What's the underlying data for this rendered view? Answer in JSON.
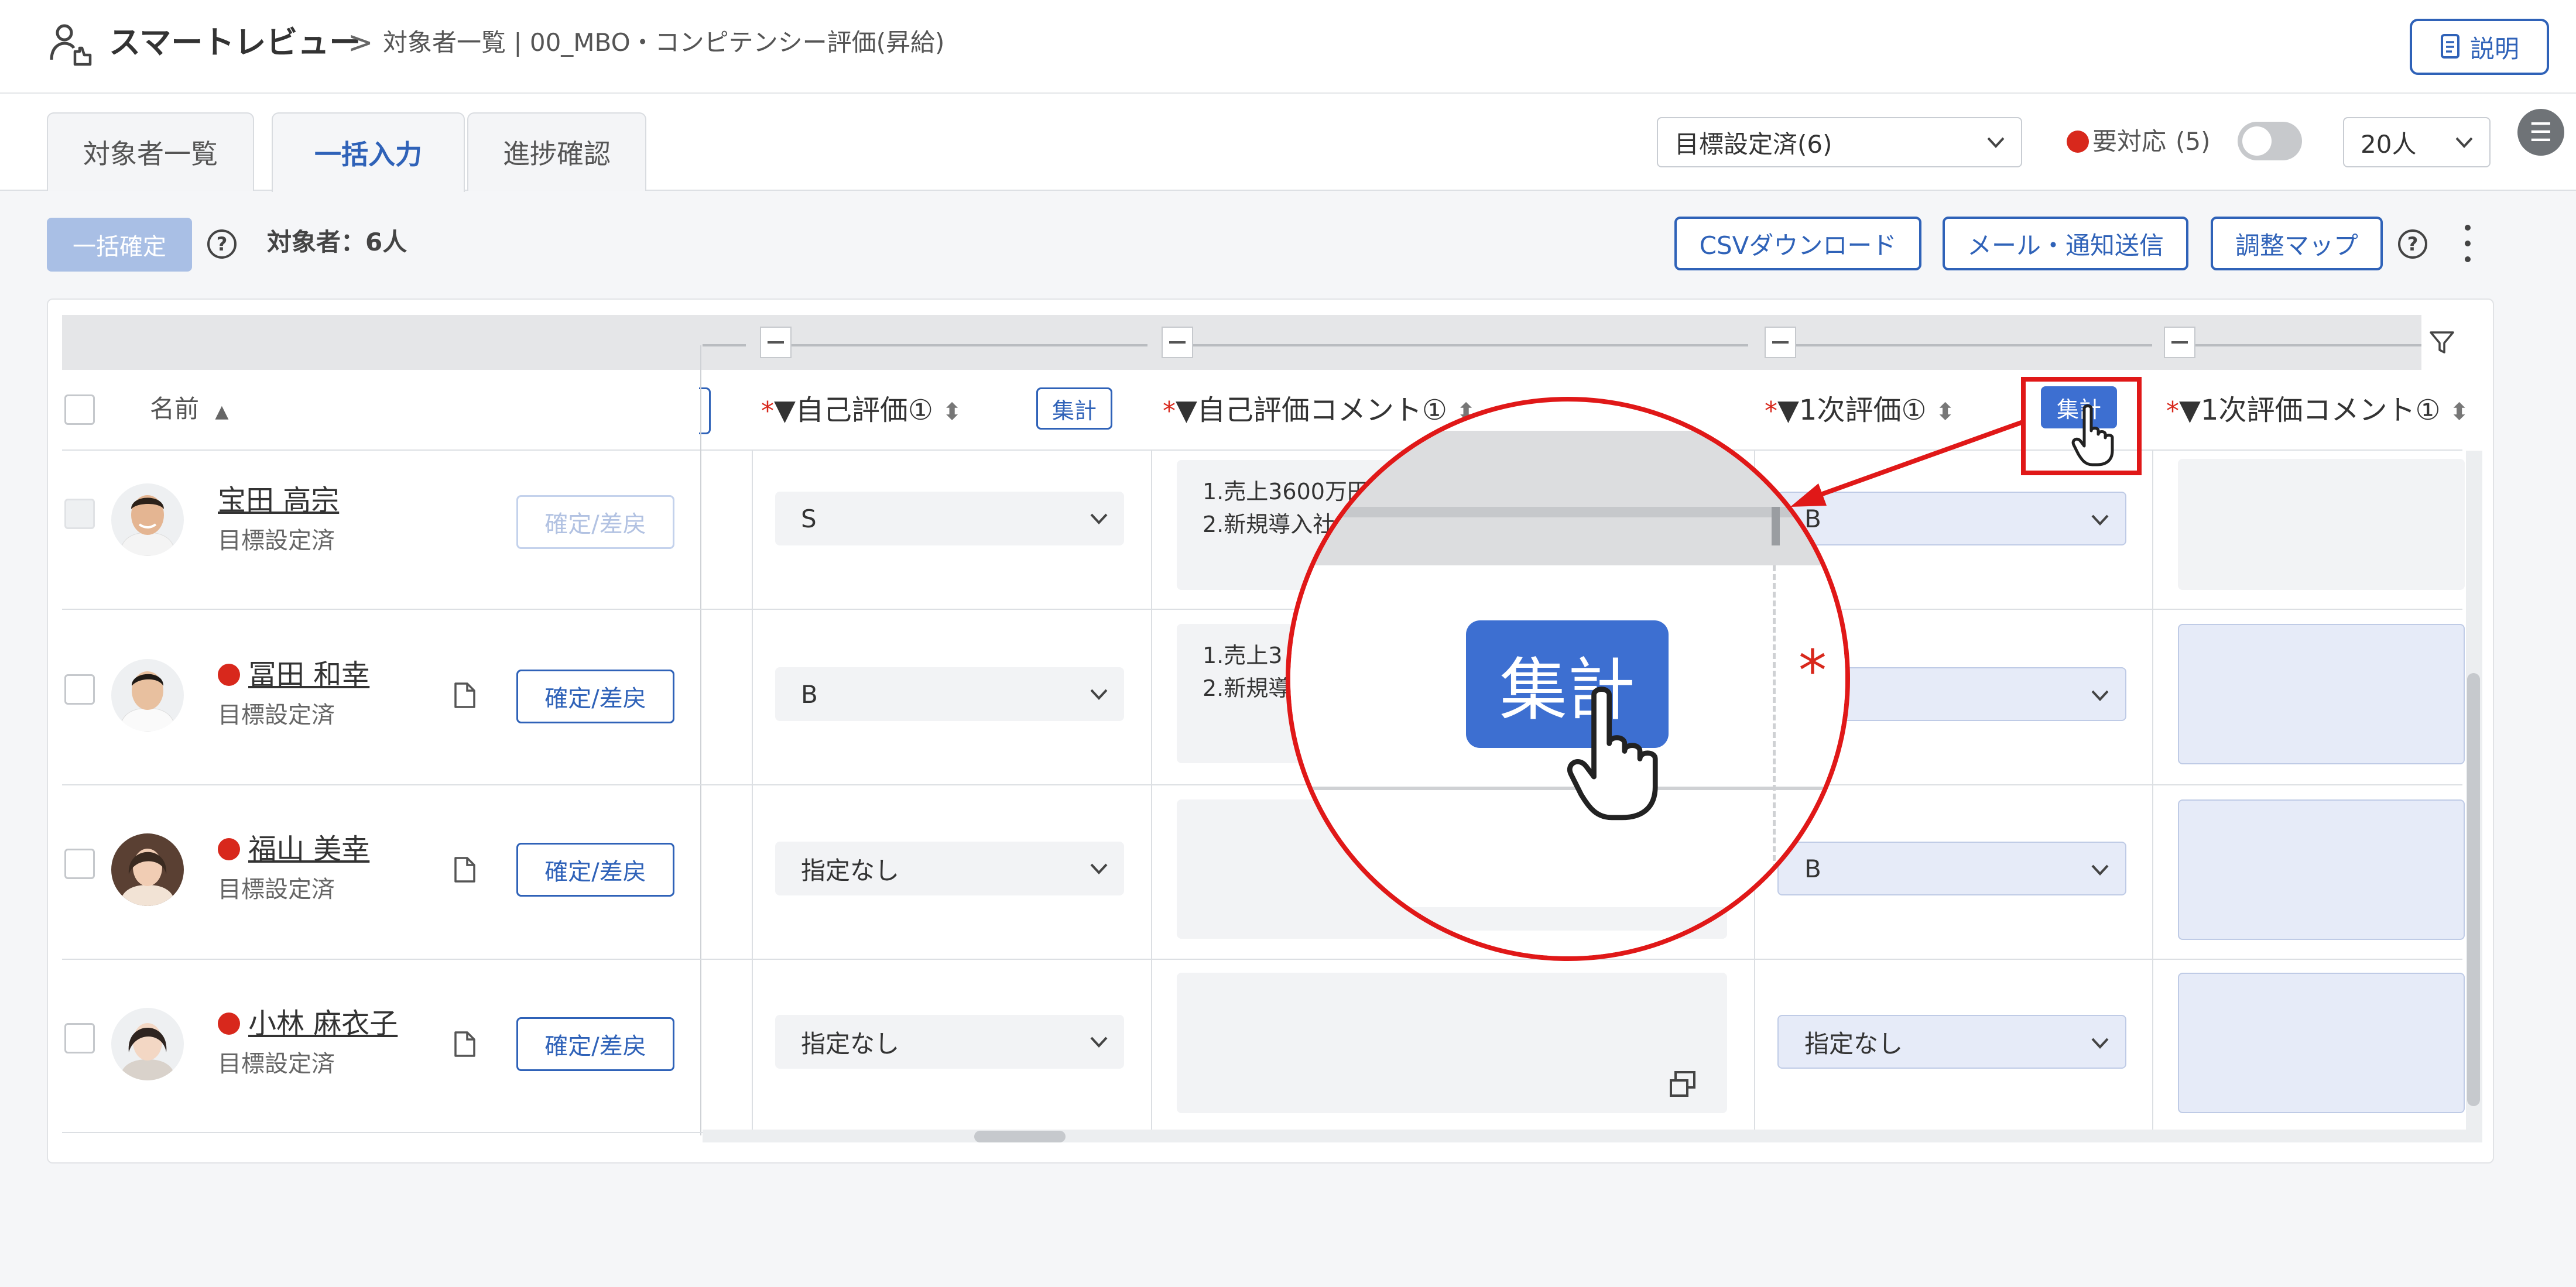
{
  "header": {
    "app_title": "スマートレビュー",
    "breadcrumb_sep": ">",
    "breadcrumb": "対象者一覧 | 00_MBO・コンピテンシー評価(昇給)",
    "help_label": "説明"
  },
  "tabs": [
    {
      "label": "対象者一覧"
    },
    {
      "label": "一括入力"
    },
    {
      "label": "進捗確認"
    }
  ],
  "filters": {
    "status_select": "目標設定済(6)",
    "needs_action_label": "要対応",
    "needs_action_count": "(5)",
    "per_page_select": "20人"
  },
  "menu_icon": "☰",
  "actions": {
    "bulk_confirm": "一括確定",
    "help_mark": "?",
    "target_count": "対象者：6人",
    "csv_download": "CSVダウンロード",
    "mail_notify": "メール・通知送信",
    "adjust_map": "調整マップ"
  },
  "table": {
    "columns": {
      "name": "名前",
      "name_sort": "▲",
      "self_eval": "▼自己評価①",
      "self_eval_comment": "▼自己評価コメント①",
      "first_eval": "▼1次評価①",
      "first_eval_comment": "▼1次評価コメント①",
      "required_mark": "*",
      "sort_mark": "⬍",
      "tally_label": "集計"
    },
    "rows": [
      {
        "name": "宝田 高宗",
        "status": "目標設定済",
        "confirm": "確定/差戻",
        "self_eval": "S",
        "comment_line1": "1.売上3600万円",
        "comment_line2": "2.新規導入社",
        "first_eval": "B"
      },
      {
        "name": "冨田 和幸",
        "status": "目標設定済",
        "confirm": "確定/差戻",
        "self_eval": "B",
        "comment_line1": "1.売上3",
        "comment_line2": "2.新規導",
        "first_eval": ""
      },
      {
        "name": "福山 美幸",
        "status": "目標設定済",
        "confirm": "確定/差戻",
        "self_eval": "指定なし",
        "comment_line1": "",
        "comment_line2": "",
        "first_eval": "B"
      },
      {
        "name": "小林 麻衣子",
        "status": "目標設定済",
        "confirm": "確定/差戻",
        "self_eval": "指定なし",
        "comment_line1": "",
        "comment_line2": "",
        "first_eval": "指定なし"
      }
    ]
  },
  "zoom": {
    "button_label": "集計",
    "asterisk": "*"
  },
  "colors": {
    "accent": "#2f62b8",
    "alert_red": "#d8281c",
    "annotation_red": "#e01818",
    "tally_button": "#3d6fd1"
  }
}
